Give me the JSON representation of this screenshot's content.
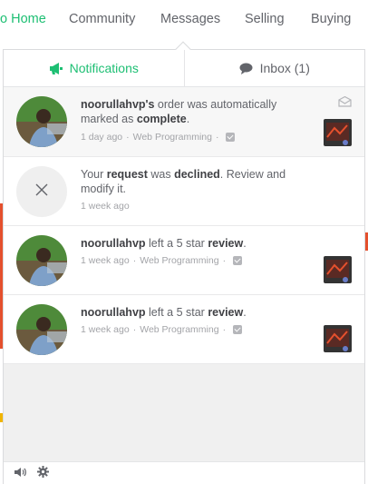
{
  "nav": {
    "items": [
      {
        "label": "o Home",
        "active": true
      },
      {
        "label": "Community",
        "active": false
      },
      {
        "label": "Messages",
        "active": false
      },
      {
        "label": "Selling",
        "active": false
      },
      {
        "label": "Buying",
        "active": false
      }
    ]
  },
  "panel": {
    "tabs": [
      {
        "label": "Notifications",
        "icon": "megaphone-icon",
        "active": true
      },
      {
        "label": "Inbox (1)",
        "icon": "chat-bubble-icon",
        "active": false
      }
    ],
    "notifications": [
      {
        "user": "noorullahvp's",
        "pre": "",
        "mid": " order was automatically marked as ",
        "bold2": "complete",
        "post": ".",
        "time": "1 day ago",
        "category": "Web Programming",
        "unread": true
      },
      {
        "pre": "Your ",
        "bold1": "request",
        "mid": " was ",
        "bold2": "declined",
        "post": ". Review and modify it.",
        "time": "1 week ago"
      },
      {
        "user": "noorullahvp",
        "mid": " left a 5 star ",
        "bold2": "review",
        "post": ".",
        "time": "1 week ago",
        "category": "Web Programming"
      },
      {
        "user": "noorullahvp",
        "mid": " left a 5 star ",
        "bold2": "review",
        "post": ".",
        "time": "1 week ago",
        "category": "Web Programming"
      }
    ]
  },
  "footer": {
    "icons": [
      "speaker-icon",
      "gear-icon"
    ]
  },
  "colors": {
    "accent": "#1dbf73",
    "text": "#404145",
    "muted": "#a3a4a8"
  }
}
